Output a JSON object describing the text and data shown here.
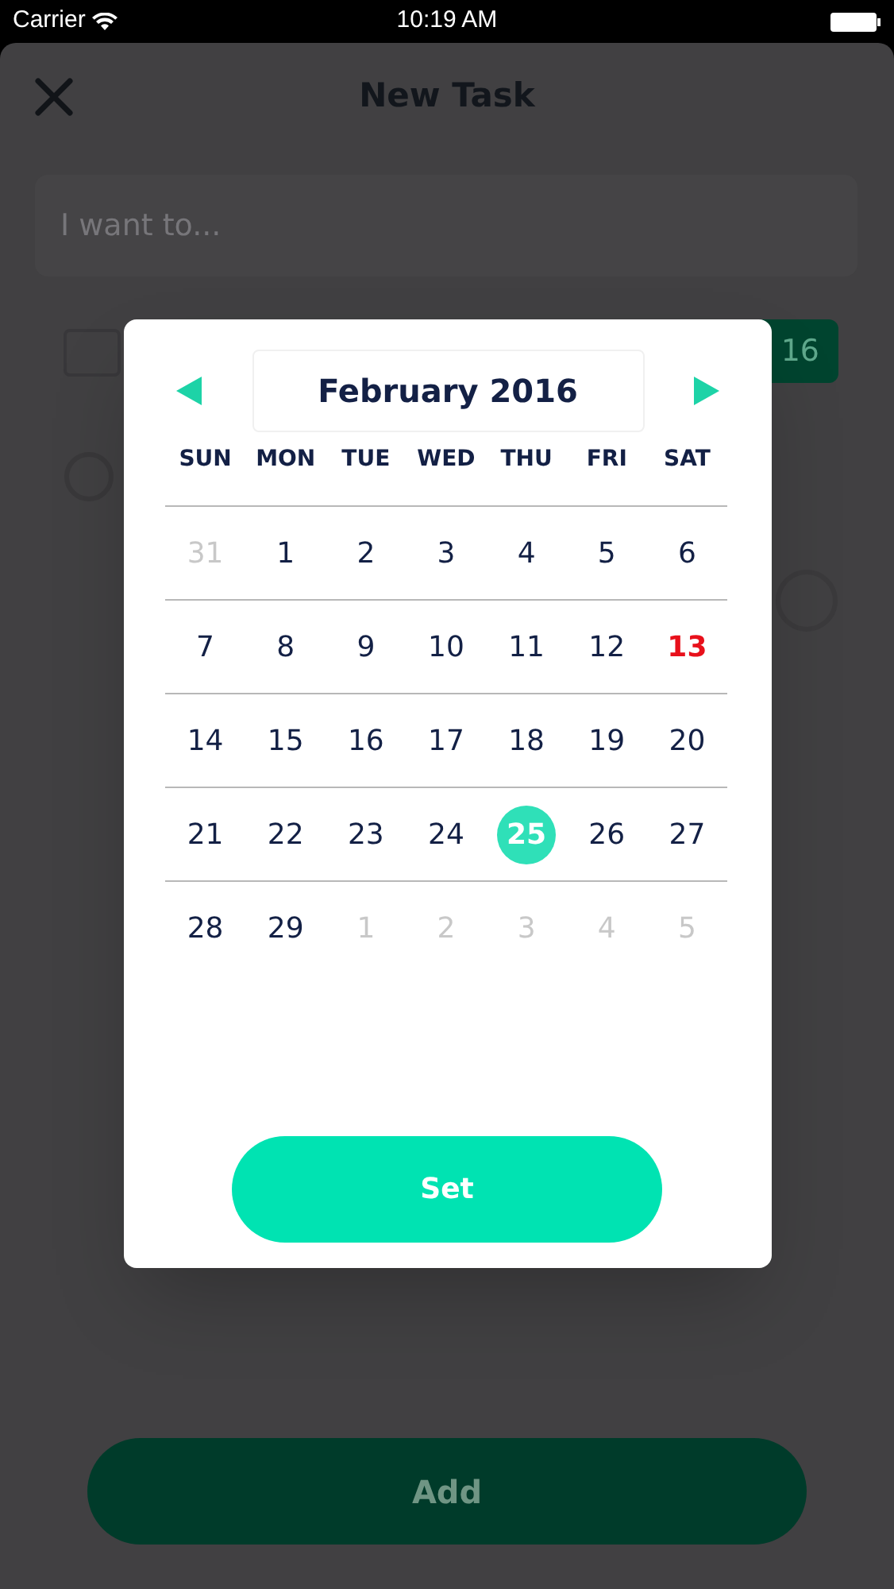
{
  "status_bar": {
    "carrier": "Carrier",
    "time": "10:19 AM"
  },
  "screen": {
    "title": "New Task",
    "task_field": {
      "placeholder": "I want to..."
    },
    "date_chip": "16",
    "add_button": "Add"
  },
  "calendar": {
    "month": "February 2016",
    "weekdays": [
      "SUN",
      "MON",
      "TUE",
      "WED",
      "THU",
      "FRI",
      "SAT"
    ],
    "weeks": [
      [
        {
          "day": "31",
          "kind": "adjacent",
          "selected": false
        },
        {
          "day": "1",
          "kind": "current",
          "selected": false
        },
        {
          "day": "2",
          "kind": "current",
          "selected": false
        },
        {
          "day": "3",
          "kind": "current",
          "selected": false
        },
        {
          "day": "4",
          "kind": "current",
          "selected": false
        },
        {
          "day": "5",
          "kind": "current",
          "selected": false
        },
        {
          "day": "6",
          "kind": "current",
          "selected": false
        }
      ],
      [
        {
          "day": "7",
          "kind": "current",
          "selected": false
        },
        {
          "day": "8",
          "kind": "current",
          "selected": false
        },
        {
          "day": "9",
          "kind": "current",
          "selected": false
        },
        {
          "day": "10",
          "kind": "current",
          "selected": false
        },
        {
          "day": "11",
          "kind": "current",
          "selected": false
        },
        {
          "day": "12",
          "kind": "current",
          "selected": false
        },
        {
          "day": "13",
          "kind": "highlighted",
          "selected": false
        }
      ],
      [
        {
          "day": "14",
          "kind": "current",
          "selected": false
        },
        {
          "day": "15",
          "kind": "current",
          "selected": false
        },
        {
          "day": "16",
          "kind": "current",
          "selected": false
        },
        {
          "day": "17",
          "kind": "current",
          "selected": false
        },
        {
          "day": "18",
          "kind": "current",
          "selected": false
        },
        {
          "day": "19",
          "kind": "current",
          "selected": false
        },
        {
          "day": "20",
          "kind": "current",
          "selected": false
        }
      ],
      [
        {
          "day": "21",
          "kind": "current",
          "selected": false
        },
        {
          "day": "22",
          "kind": "current",
          "selected": false
        },
        {
          "day": "23",
          "kind": "current",
          "selected": false
        },
        {
          "day": "24",
          "kind": "current",
          "selected": false
        },
        {
          "day": "25",
          "kind": "current",
          "selected": true
        },
        {
          "day": "26",
          "kind": "current",
          "selected": false
        },
        {
          "day": "27",
          "kind": "current",
          "selected": false
        }
      ],
      [
        {
          "day": "28",
          "kind": "current",
          "selected": false
        },
        {
          "day": "29",
          "kind": "current",
          "selected": false
        },
        {
          "day": "1",
          "kind": "adjacent",
          "selected": false
        },
        {
          "day": "2",
          "kind": "adjacent",
          "selected": false
        },
        {
          "day": "3",
          "kind": "adjacent",
          "selected": false
        },
        {
          "day": "4",
          "kind": "adjacent",
          "selected": false
        },
        {
          "day": "5",
          "kind": "adjacent",
          "selected": false
        }
      ]
    ],
    "set_button": "Set"
  }
}
